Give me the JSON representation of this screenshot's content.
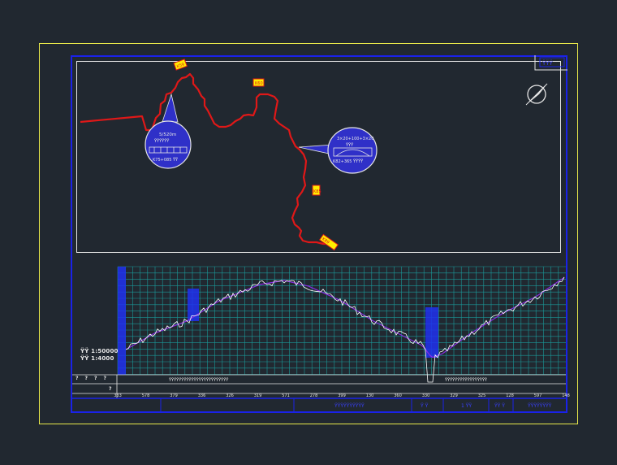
{
  "colors": {
    "background": "#212830",
    "sheet_border": "#e8e84a",
    "frame": "#1a22e8",
    "route": "#e01818",
    "grid": "#1a9a9a",
    "ground_line": "#ffffff",
    "design_line": "#8a2be2",
    "callout_fill": "#2f30c8",
    "marker_fill": "#ffee00"
  },
  "icons": [
    "north-arrow-icon",
    "bridge-icon"
  ],
  "profile": {
    "scale_h": "ŸŸ 1:50000",
    "scale_v": "ŸŸ 1:4000",
    "left_row_marks": [
      "?",
      "?",
      "?",
      "?",
      "?"
    ],
    "station_ticks": [
      "333",
      "578",
      "379",
      "336",
      "326",
      "319",
      "571",
      "278",
      "399",
      "130",
      "360",
      "330",
      "329",
      "325",
      "128",
      "597",
      "148"
    ],
    "row_text_left": "ŸŸŸŸŸŸŸŸŸŸŸŸŸŸŸŸŸŸŸŸŸŸŸŸ",
    "row_text_right": "ŸŸŸŸŸŸŸŸŸŸŸŸŸŸŸŸŸ"
  },
  "callouts": {
    "left": {
      "line1": "5/520m",
      "line2": "ŸŸŸŸŸŸ",
      "line3": "K75+085 ŸŸ"
    },
    "right": {
      "line1": "3×20+100+3×20",
      "line2": "ŸŸŸ",
      "line3": "K82+365 ŸŸŸŸ"
    }
  },
  "markers": [
    "K59",
    "K60",
    "K85",
    "K86",
    "K89"
  ],
  "title_block": {
    "drawing_name": "ŸŸŸŸŸŸŸŸŸŸ",
    "label1": "Ÿ Ÿ",
    "value1": "1 ŸŸ",
    "label2": "ŸŸ Ÿ",
    "value2": "ŸŸŸŸŸŸŸŸ"
  },
  "stamp": "ŸŸŸ"
}
